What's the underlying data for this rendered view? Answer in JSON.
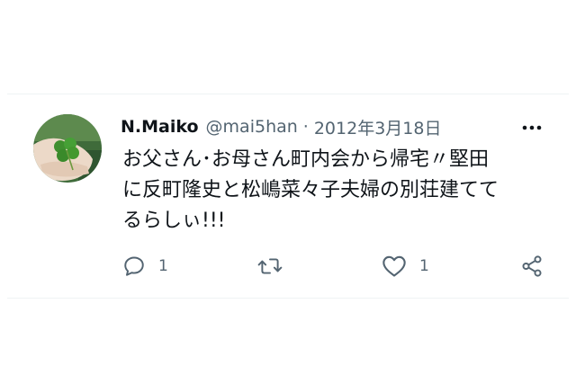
{
  "tweet": {
    "display_name": "N.Maiko",
    "handle": "@mai5han",
    "separator": "·",
    "date": "2012年3月18日",
    "text": "お父さん･お母さん町内会から帰宅〃堅田\nに反町隆史と松嶋菜々子夫婦の別荘建てて\nるらしぃ!!!",
    "more_icon": "more-horizontal-icon",
    "avatar_description_icon": "clover-leaf-photo"
  },
  "actions": {
    "reply": {
      "icon": "reply-icon",
      "count": "1"
    },
    "retweet": {
      "icon": "retweet-icon",
      "count": ""
    },
    "like": {
      "icon": "heart-icon",
      "count": "1"
    },
    "share": {
      "icon": "share-icon"
    }
  },
  "colors": {
    "text_primary": "#0f1419",
    "text_secondary": "#536471",
    "border": "#eff3f4"
  }
}
